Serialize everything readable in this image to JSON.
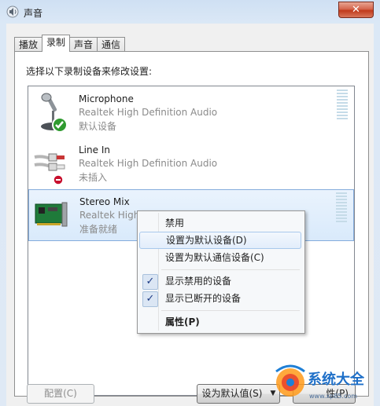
{
  "window": {
    "title": "声音",
    "close_glyph": "✕"
  },
  "tabs": [
    {
      "label": "播放",
      "active": false
    },
    {
      "label": "录制",
      "active": true
    },
    {
      "label": "声音",
      "active": false
    },
    {
      "label": "通信",
      "active": false
    }
  ],
  "instruction": "选择以下录制设备来修改设置:",
  "devices": [
    {
      "name": "Microphone",
      "description": "Realtek High Definition Audio",
      "status": "默认设备",
      "icon": "microphone-icon",
      "badge": "default-check-badge-icon"
    },
    {
      "name": "Line In",
      "description": "Realtek High Definition Audio",
      "status": "未插入",
      "icon": "line-in-cable-icon",
      "badge": "unplugged-badge-icon"
    },
    {
      "name": "Stereo Mix",
      "description": "Realtek High",
      "status": "准备就绪",
      "icon": "sound-card-icon",
      "selected": true
    }
  ],
  "context_menu": {
    "items": [
      {
        "label": "禁用",
        "checked": false
      },
      {
        "label": "设置为默认设备(D)",
        "checked": false,
        "highlighted": true
      },
      {
        "label": "设置为默认通信设备(C)",
        "checked": false
      },
      {
        "label": "显示禁用的设备",
        "checked": true
      },
      {
        "label": "显示已断开的设备",
        "checked": true
      },
      {
        "label": "属性(P)",
        "checked": false,
        "bold": true
      }
    ],
    "check_glyph": "✓"
  },
  "buttons": {
    "configure": "配置(C)",
    "set_default": "设为默认值(S)",
    "properties_partial": "性(P)",
    "dropdown_glyph": "▼"
  },
  "watermark": {
    "text": "系统大全",
    "url": "www.xp85.com"
  },
  "colors": {
    "accent": "#3a7bd5",
    "selection": "#d9eafb",
    "close": "#c03a1b"
  }
}
